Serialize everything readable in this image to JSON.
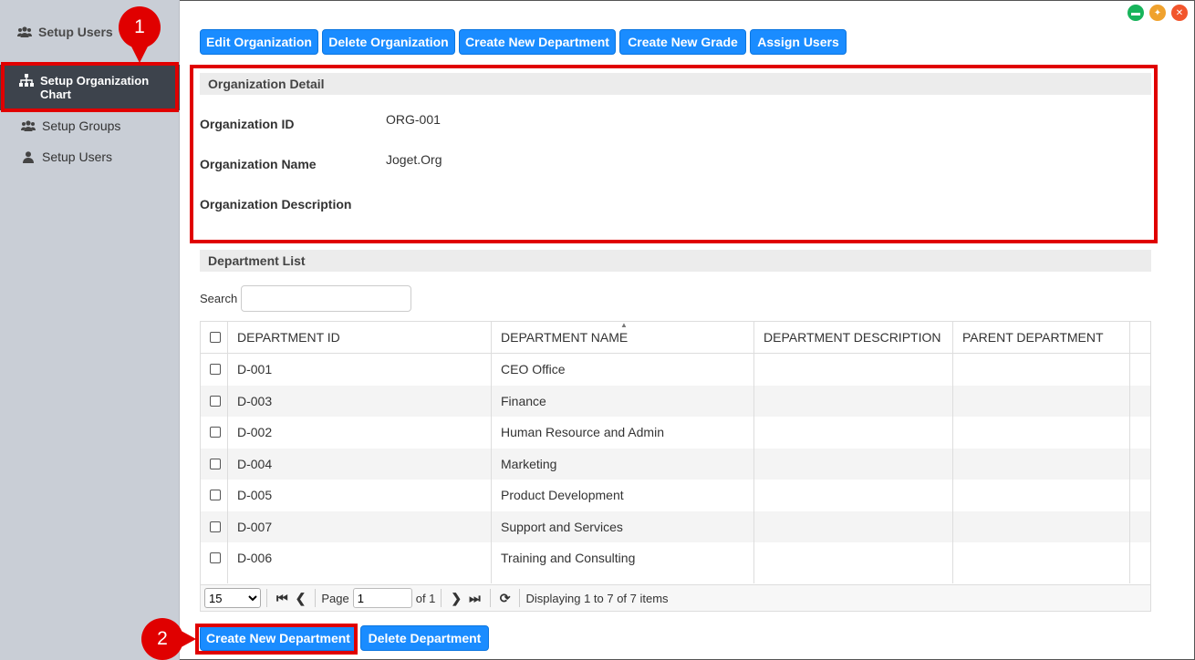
{
  "sidebar": {
    "top_label": "Setup Users",
    "active_label": "Setup Organization Chart",
    "items": [
      {
        "label": "Setup Groups",
        "icon": "users-icon"
      },
      {
        "label": "Setup Users",
        "icon": "user-icon"
      }
    ]
  },
  "annotations": {
    "badge1": "1",
    "badge2": "2"
  },
  "toolbar": {
    "edit_org": "Edit Organization",
    "delete_org": "Delete Organization",
    "create_dept": "Create New Department",
    "create_grade": "Create New Grade",
    "assign_users": "Assign Users"
  },
  "org_detail": {
    "heading": "Organization Detail",
    "id_label": "Organization ID",
    "id_value": "ORG-001",
    "name_label": "Organization Name",
    "name_value": "Joget.Org",
    "desc_label": "Organization Description",
    "desc_value": ""
  },
  "dept_list": {
    "heading": "Department List",
    "search_label": "Search",
    "search_value": "",
    "columns": [
      "DEPARTMENT ID",
      "DEPARTMENT NAME",
      "DEPARTMENT DESCRIPTION",
      "PARENT DEPARTMENT"
    ],
    "rows": [
      {
        "id": "D-001",
        "name": "CEO Office"
      },
      {
        "id": "D-003",
        "name": "Finance"
      },
      {
        "id": "D-002",
        "name": "Human Resource and Admin"
      },
      {
        "id": "D-004",
        "name": "Marketing"
      },
      {
        "id": "D-005",
        "name": "Product Development"
      },
      {
        "id": "D-007",
        "name": "Support and Services"
      },
      {
        "id": "D-006",
        "name": "Training and Consulting"
      }
    ]
  },
  "pager": {
    "page_size": "15",
    "page_label": "Page",
    "page_value": "1",
    "of_label": "of 1",
    "display_text": "Displaying 1 to 7 of 7 items"
  },
  "bottom": {
    "create_dept": "Create New Department",
    "delete_dept": "Delete Department"
  },
  "colors": {
    "accent": "#1a8cff",
    "highlight": "#e00000",
    "sidebar_active": "#3d434c"
  }
}
